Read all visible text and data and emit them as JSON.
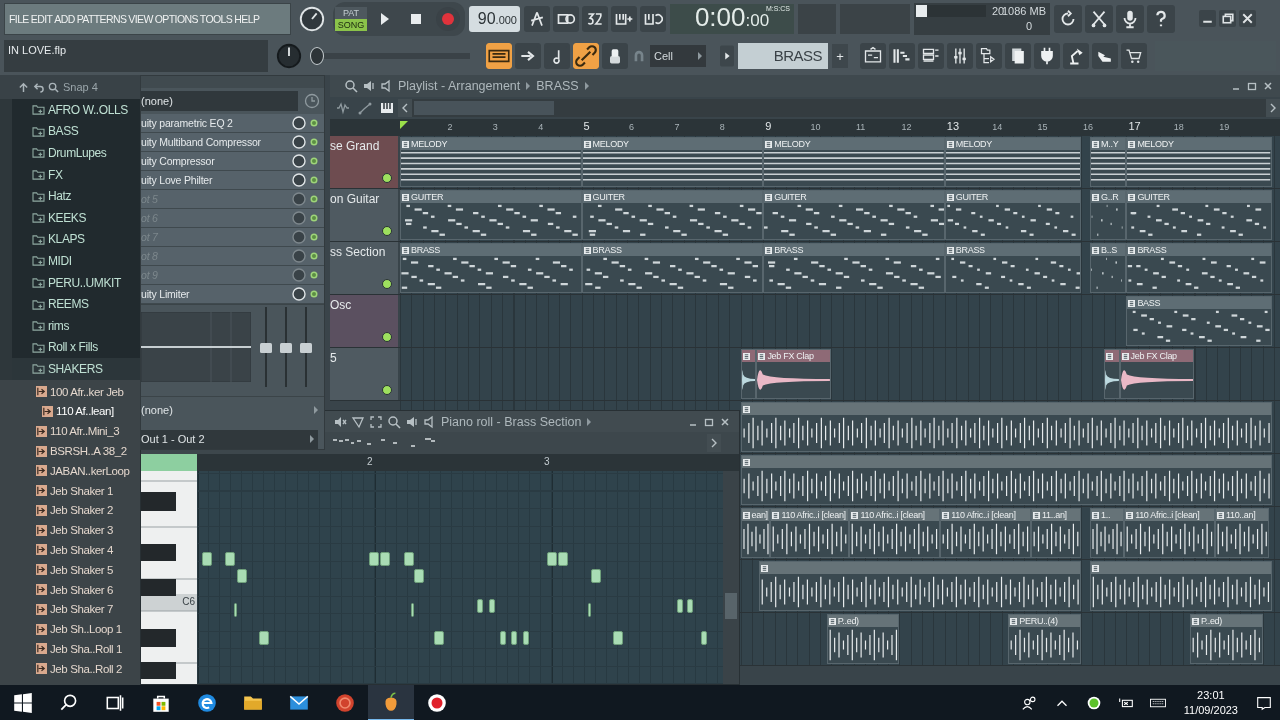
{
  "menu": [
    "FILE",
    "EDIT",
    "ADD",
    "PATTERNS",
    "VIEW",
    "OPTIONS",
    "TOOLS",
    "HELP"
  ],
  "project": "IN LOVE.flp",
  "transport": {
    "pat": "PAT",
    "song": "SONG",
    "song_mode": true,
    "tempo": "90",
    "tempo_fraction": ".000"
  },
  "time": {
    "main": "0:00",
    "cs": ":00",
    "format": "M:S:CS"
  },
  "monitor": {
    "voices": "20",
    "memory": "1086 MB",
    "count": "0",
    "level": 0.15
  },
  "pitch": {
    "level": 0
  },
  "toggles": [
    {
      "on": true
    },
    {
      "on": false
    },
    {
      "on": false
    },
    {
      "on": true
    }
  ],
  "snap": "Cell",
  "pattern": {
    "name": "BRASS",
    "add": "+"
  },
  "browser": {
    "snap": "Snap 4",
    "folders": [
      {
        "label": "AFRO W..OLLS",
        "selected": false
      },
      {
        "label": "BASS",
        "selected": false
      },
      {
        "label": "DrumLupes",
        "selected": false
      },
      {
        "label": "FX",
        "selected": false
      },
      {
        "label": "Hatz",
        "selected": false
      },
      {
        "label": "KEEKS",
        "selected": false
      },
      {
        "label": "KLAPS",
        "selected": false
      },
      {
        "label": "MIDI",
        "selected": false
      },
      {
        "label": "PERU..UMKIT",
        "selected": false
      },
      {
        "label": "REEMS",
        "selected": false
      },
      {
        "label": "rims",
        "selected": false
      },
      {
        "label": "Roll x Fills",
        "selected": false
      },
      {
        "label": "SHAKERS",
        "selected": true
      }
    ],
    "files": [
      {
        "label": "100 Afr..ker Jeb",
        "selected": false
      },
      {
        "label": "110 Af..lean]",
        "selected": true
      },
      {
        "label": "110 Afr..Mini_3",
        "selected": false
      },
      {
        "label": "BSRSH..A 38_2",
        "selected": false
      },
      {
        "label": "JABAN..kerLoop",
        "selected": false
      },
      {
        "label": "Jeb Shaker 1",
        "selected": false
      },
      {
        "label": "Jeb Shaker 2",
        "selected": false
      },
      {
        "label": "Jeb Shaker 3",
        "selected": false
      },
      {
        "label": "Jeb Shaker 4",
        "selected": false
      },
      {
        "label": "Jeb Shaker 5",
        "selected": false
      },
      {
        "label": "Jeb Shaker 6",
        "selected": false
      },
      {
        "label": "Jeb Shaker 7",
        "selected": false
      },
      {
        "label": "Jeb Sh..Loop 1",
        "selected": false
      },
      {
        "label": "Jeb Sha..Roll 1",
        "selected": false
      },
      {
        "label": "Jeb Sha..Roll 2",
        "selected": false
      }
    ]
  },
  "mixer": {
    "input": "(none)",
    "slots": [
      {
        "label": "uity parametric EQ 2",
        "empty": false
      },
      {
        "label": "uity Multiband Compressor",
        "empty": false
      },
      {
        "label": "uity Compressor",
        "empty": false
      },
      {
        "label": "uity Love Philter",
        "empty": false
      },
      {
        "label": "ot 5",
        "empty": true
      },
      {
        "label": "ot 6",
        "empty": true
      },
      {
        "label": "ot 7",
        "empty": true
      },
      {
        "label": "ot 8",
        "empty": true
      },
      {
        "label": "ot 9",
        "empty": true
      },
      {
        "label": "uity Limiter",
        "empty": false
      }
    ],
    "send": "(none)",
    "output": "Out 1 - Out 2"
  },
  "playlist": {
    "title": "Playlist - Arrangement",
    "pattern": "BRASS",
    "ruler": [
      {
        "label": "2",
        "major": false
      },
      {
        "label": "3",
        "major": false
      },
      {
        "label": "4",
        "major": false
      },
      {
        "label": "5",
        "major": true
      },
      {
        "label": "6",
        "major": false
      },
      {
        "label": "7",
        "major": false
      },
      {
        "label": "8",
        "major": false
      },
      {
        "label": "9",
        "major": true
      },
      {
        "label": "10",
        "major": false
      },
      {
        "label": "11",
        "major": false
      },
      {
        "label": "12",
        "major": false
      },
      {
        "label": "13",
        "major": true
      },
      {
        "label": "14",
        "major": false
      },
      {
        "label": "15",
        "major": false
      },
      {
        "label": "16",
        "major": false
      },
      {
        "label": "17",
        "major": true
      },
      {
        "label": "18",
        "major": false
      },
      {
        "label": "19",
        "major": false
      }
    ],
    "tracks": [
      {
        "name": "se Grand",
        "color": "#6e4c50",
        "enabled": true,
        "clips": [
          {
            "kind": "lines",
            "label": "MELODY"
          },
          {
            "kind": "lines",
            "label": "MELODY"
          },
          {
            "kind": "lines",
            "label": "MELODY"
          },
          {
            "kind": "lines",
            "label": "MELODY"
          },
          {
            "kind": "lines",
            "label": "M..Y"
          },
          {
            "kind": "lines",
            "label": "MELODY"
          }
        ]
      },
      {
        "name": "on Guitar",
        "color": "#4f5a61",
        "enabled": true,
        "clips": [
          {
            "kind": "notes",
            "label": "GUITER"
          },
          {
            "kind": "notes",
            "label": "GUITER"
          },
          {
            "kind": "notes",
            "label": "GUITER"
          },
          {
            "kind": "notes",
            "label": "GUITER"
          },
          {
            "kind": "notes",
            "label": "G..R"
          },
          {
            "kind": "notes",
            "label": "GUITER"
          }
        ]
      },
      {
        "name": "ss Section",
        "color": "#4f5a61",
        "enabled": true,
        "clips": [
          {
            "kind": "notes",
            "label": "BRASS"
          },
          {
            "kind": "notes",
            "label": "BRASS"
          },
          {
            "kind": "notes",
            "label": "BRASS"
          },
          {
            "kind": "notes",
            "label": "BRASS"
          },
          {
            "kind": "notes",
            "label": "B..S"
          },
          {
            "kind": "notes",
            "label": "BRASS"
          }
        ]
      },
      {
        "name": "Osc",
        "color": "#5b5060",
        "enabled": true,
        "clips": [
          {
            "kind": "notes",
            "label": "BASS"
          }
        ]
      },
      {
        "name": "5",
        "color": "#4f5a61",
        "enabled": true,
        "clips": [
          {
            "kind": "clap"
          },
          {
            "kind": "clap",
            "label": "Jeb FX Clap"
          },
          {
            "kind": "clap"
          },
          {
            "kind": "clap",
            "label": "Jeb FX Clap"
          }
        ]
      },
      {
        "clips": [
          {
            "kind": "audio"
          }
        ]
      },
      {
        "clips": [
          {
            "kind": "audio"
          }
        ]
      },
      {
        "clips": [
          {
            "kind": "audio",
            "label": "ean]"
          },
          {
            "kind": "audio",
            "label": "110 Afric..i [clean]"
          },
          {
            "kind": "audio",
            "label": "110 Afric..i [clean]"
          },
          {
            "kind": "audio",
            "label": "110 Afric..i [clean]"
          },
          {
            "kind": "audio",
            "label": "11..an]"
          },
          {
            "kind": "audio",
            "label": "1.."
          },
          {
            "kind": "audio",
            "label": "110 Afric..i [clean]"
          },
          {
            "kind": "audio",
            "label": "110..an]"
          }
        ]
      },
      {
        "clips": [
          {
            "kind": "audio"
          },
          {
            "kind": "audio"
          }
        ]
      },
      {
        "clips": [
          {
            "kind": "audio",
            "label": "P..ed)"
          },
          {
            "kind": "audio",
            "label": "PERU..(4)"
          },
          {
            "kind": "audio",
            "label": "P..ed)"
          }
        ]
      }
    ]
  },
  "piano_roll": {
    "title": "Piano roll - Brass Section",
    "ruler": [
      "2",
      "3"
    ],
    "key_label": "C6"
  },
  "taskbar": {
    "time": "23:01",
    "date": "11/09/2023"
  }
}
